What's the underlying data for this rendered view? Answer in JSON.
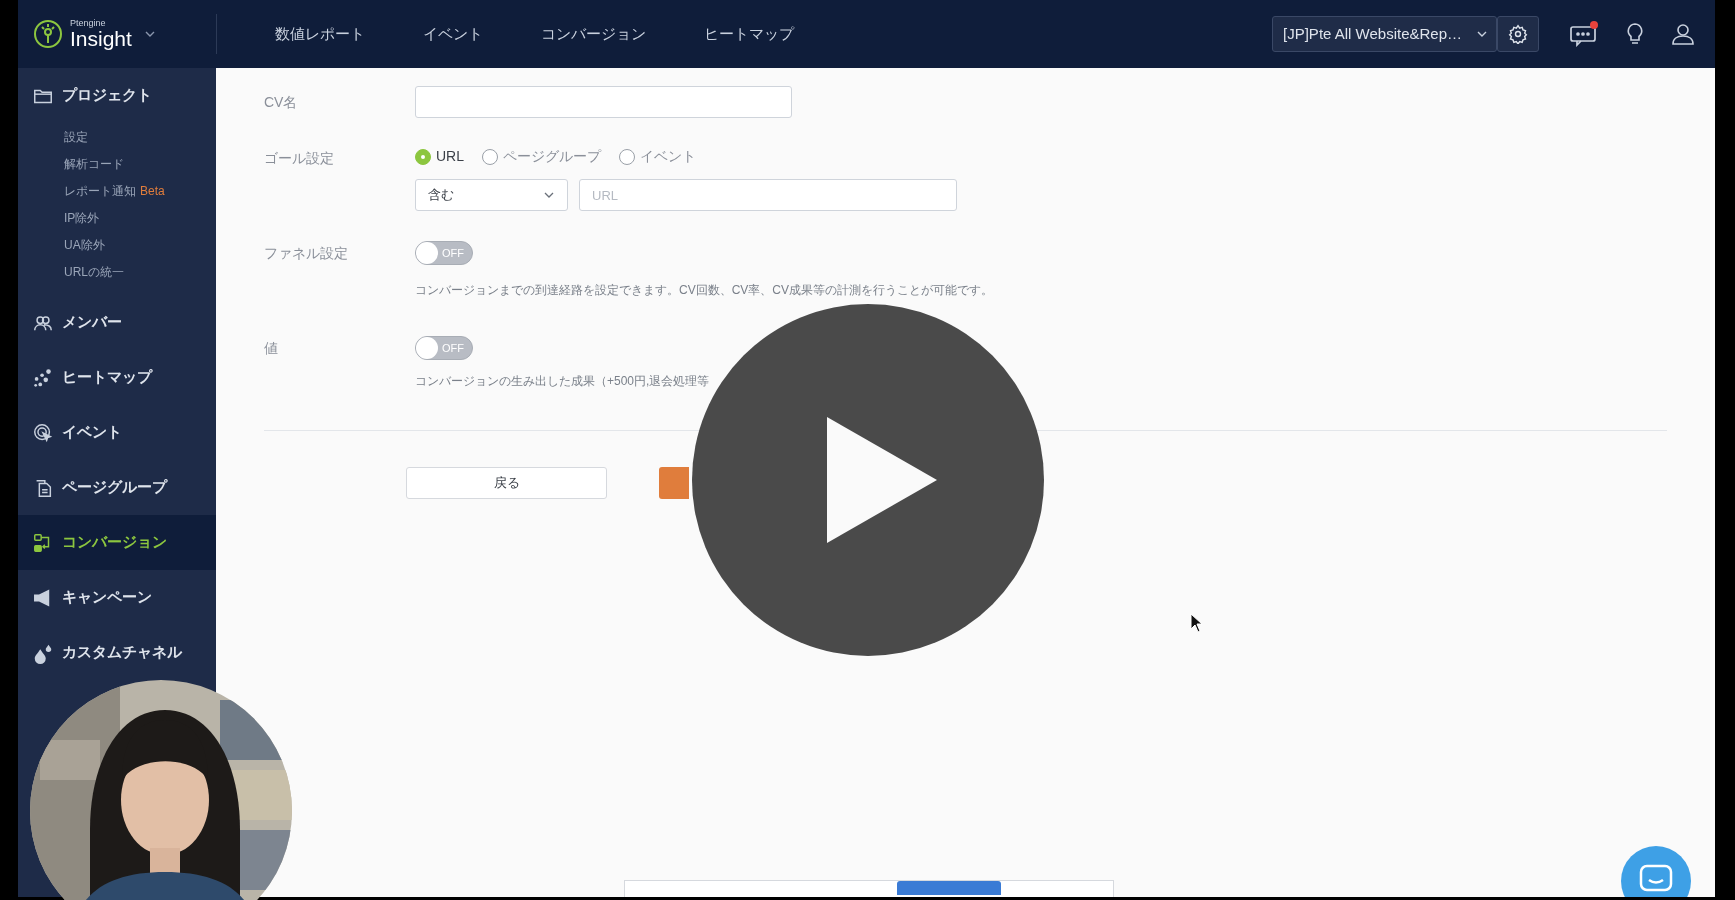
{
  "header": {
    "logo_caption": "Ptengine",
    "logo": "Insight",
    "nav": [
      {
        "label": "数値レポート"
      },
      {
        "label": "イベント"
      },
      {
        "label": "コンバージョン"
      },
      {
        "label": "ヒートマップ"
      }
    ],
    "project_selector": "[JP]Pte All Website&Rep…",
    "has_notification": true
  },
  "sidebar": [
    {
      "kind": "folder",
      "label": "プロジェクト",
      "selected": false,
      "children": [
        {
          "label": "設定"
        },
        {
          "label": "解析コード"
        },
        {
          "label": "レポート通知",
          "badge": "Beta"
        },
        {
          "label": "IP除外"
        },
        {
          "label": "UA除外"
        },
        {
          "label": "URLの統一"
        }
      ]
    },
    {
      "kind": "members",
      "label": "メンバー",
      "selected": false
    },
    {
      "kind": "heatmap",
      "label": "ヒートマップ",
      "selected": false
    },
    {
      "kind": "event",
      "label": "イベント",
      "selected": false
    },
    {
      "kind": "pages",
      "label": "ページグループ",
      "selected": false
    },
    {
      "kind": "conversion",
      "label": "コンバージョン",
      "selected": true
    },
    {
      "kind": "campaign",
      "label": "キャンペーン",
      "selected": false
    },
    {
      "kind": "channel",
      "label": "カスタムチャネル",
      "selected": false
    }
  ],
  "form": {
    "cv_name": {
      "label": "CV名"
    },
    "goal": {
      "label": "ゴール設定",
      "options": [
        {
          "label": "URL",
          "selected": true
        },
        {
          "label": "ページグループ",
          "selected": false
        },
        {
          "label": "イベント",
          "selected": false
        }
      ],
      "match": "含む",
      "url_placeholder": "URL"
    },
    "funnel": {
      "label": "ファネル設定",
      "on": false,
      "toggle_text": "OFF",
      "help": "コンバージョンまでの到達経路を設定できます。CV回数、CV率、CV成果等の計測を行うことが可能です。"
    },
    "value": {
      "label": "値",
      "on": false,
      "toggle_text": "OFF",
      "help": "コンバージョンの生み出した成果（+500円,退会処理等"
    },
    "buttons": [
      {
        "kind": "secondary",
        "label": "戻る"
      },
      {
        "kind": "primary"
      }
    ]
  },
  "video": {
    "paused": true
  }
}
